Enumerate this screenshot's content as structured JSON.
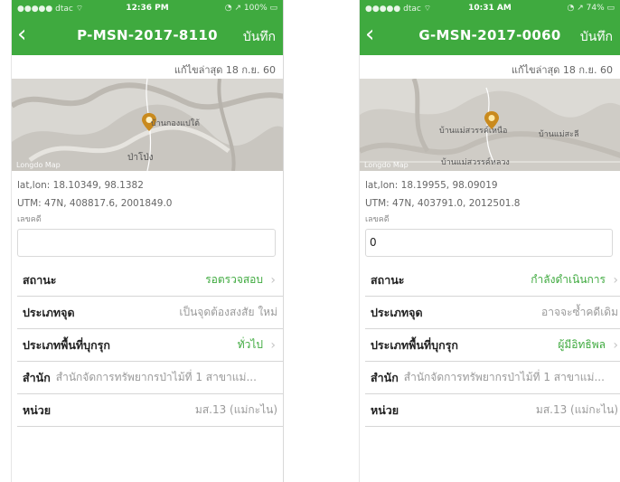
{
  "screens": [
    {
      "status": {
        "carrier": "●●●●● dtac ⌔",
        "time": "12:36 PM",
        "battery": "◔ ↗ 100% ▭"
      },
      "title": "P-MSN-2017-8110",
      "save_label": "บันทึก",
      "updated": "แก้ไขล่าสุด 18 ก.ย. 60",
      "map": {
        "labels": [
          "บ้านกองแปใต้",
          "ป่าโป่ง"
        ],
        "provider": "Longdo Map"
      },
      "latlon": "lat,lon: 18.10349, 98.1382",
      "utm": "UTM: 47N, 408817.6, 2001849.0",
      "case_label": "เลขคดี",
      "case_value": "",
      "rows": [
        {
          "label": "สถานะ",
          "value": "รอตรวจสอบ"
        },
        {
          "label": "ประเภทจุด",
          "value": "เป็นจุดต้องสงสัย ใหม่"
        },
        {
          "label": "ประเภทพื้นที่บุกรุก",
          "value": "ทั่วไป"
        },
        {
          "label": "สำนัก",
          "value": "สำนักจัดการทรัพยากรป่าไม้ที่ 1 สาขาแม่..."
        },
        {
          "label": "หน่วย",
          "value": "มส.13 (แม่กะไน)"
        }
      ]
    },
    {
      "status": {
        "carrier": "●●●●● dtac ⌔",
        "time": "10:31 AM",
        "battery": "◔ ↗ 74% ▭"
      },
      "title": "G-MSN-2017-0060",
      "save_label": "บันทึก",
      "updated": "แก้ไขล่าสุด 18 ก.ย. 60",
      "map": {
        "labels": [
          "บ้านแม่สวรรค์เหนือ",
          "บ้านแม่สะลี",
          "บ้านแม่สวรรค์หลวง"
        ],
        "provider": "Longdo Map"
      },
      "latlon": "lat,lon: 18.19955, 98.09019",
      "utm": "UTM: 47N, 403791.0, 2012501.8",
      "case_label": "เลขคดี",
      "case_value": "0",
      "rows": [
        {
          "label": "สถานะ",
          "value": "กำลังดำเนินการ"
        },
        {
          "label": "ประเภทจุด",
          "value": "อาจจะซ้ำคดีเดิม"
        },
        {
          "label": "ประเภทพื้นที่บุกรุก",
          "value": "ผู้มีอิทธิพล"
        },
        {
          "label": "สำนัก",
          "value": "สำนักจัดการทรัพยากรป่าไม้ที่ 1 สาขาแม่..."
        },
        {
          "label": "หน่วย",
          "value": "มส.13 (แม่กะไน)"
        }
      ]
    }
  ],
  "colors": {
    "header": "#3faa3f",
    "accent_green": "#3faa3f",
    "muted_text": "#9a9a9a",
    "pin": "#c98a1e"
  },
  "icons": [
    "back-chevron-icon",
    "map-pin-icon",
    "chevron-right-icon",
    "signal-icon",
    "battery-icon"
  ]
}
